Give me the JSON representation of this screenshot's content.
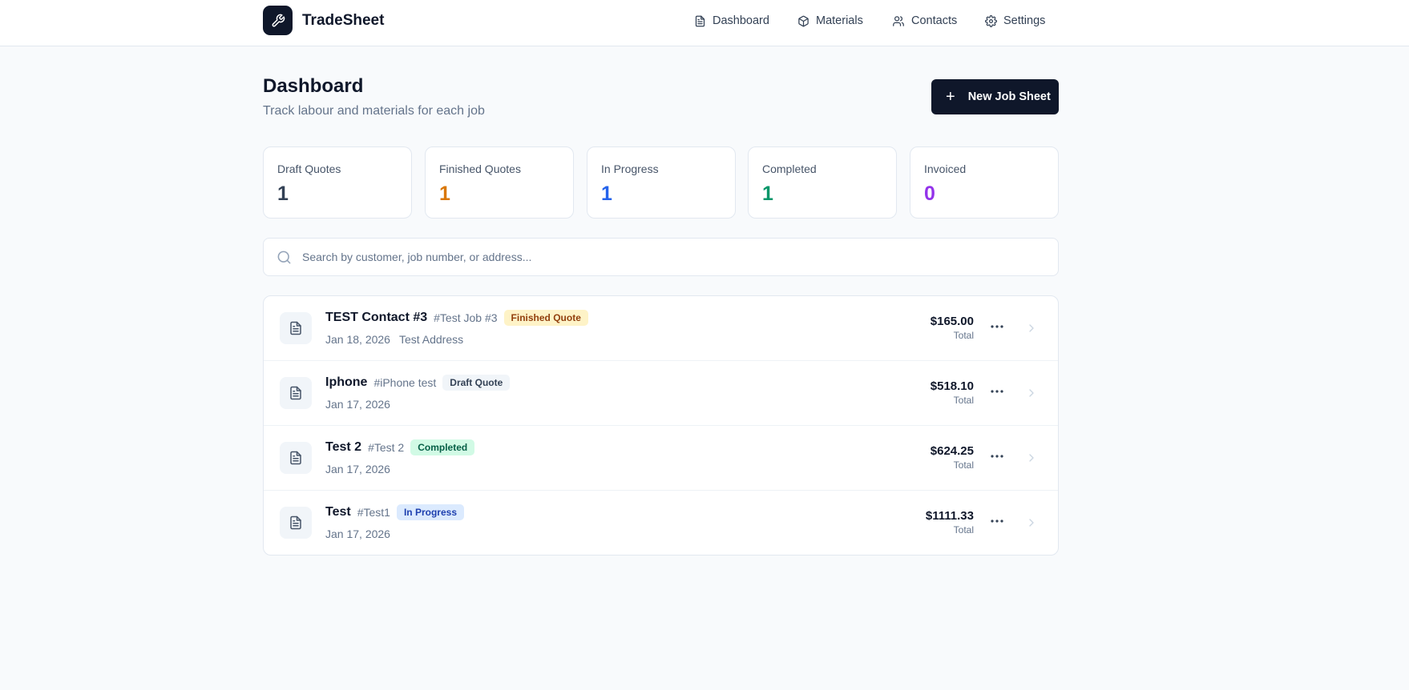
{
  "header": {
    "brand": "TradeSheet",
    "nav": [
      {
        "label": "Dashboard",
        "icon": "file-icon"
      },
      {
        "label": "Materials",
        "icon": "box-icon"
      },
      {
        "label": "Contacts",
        "icon": "users-icon"
      },
      {
        "label": "Settings",
        "icon": "gear-icon"
      }
    ]
  },
  "page": {
    "title": "Dashboard",
    "subtitle": "Track labour and materials for each job",
    "new_button": "New Job Sheet"
  },
  "stats": [
    {
      "label": "Draft Quotes",
      "value": "1",
      "color": "#334155"
    },
    {
      "label": "Finished Quotes",
      "value": "1",
      "color": "#d97706"
    },
    {
      "label": "In Progress",
      "value": "1",
      "color": "#2563eb"
    },
    {
      "label": "Completed",
      "value": "1",
      "color": "#059669"
    },
    {
      "label": "Invoiced",
      "value": "0",
      "color": "#9333ea"
    }
  ],
  "search": {
    "placeholder": "Search by customer, job number, or address..."
  },
  "jobs": [
    {
      "name": "TEST Contact #3",
      "number": "#Test Job #3",
      "status": "Finished Quote",
      "badge_bg": "#fef3c7",
      "badge_fg": "#92400e",
      "date": "Jan 18, 2026",
      "address": "Test Address",
      "amount": "$165.00",
      "amount_label": "Total"
    },
    {
      "name": "Iphone",
      "number": "#iPhone test",
      "status": "Draft Quote",
      "badge_bg": "#f1f5f9",
      "badge_fg": "#334155",
      "date": "Jan 17, 2026",
      "address": "",
      "amount": "$518.10",
      "amount_label": "Total"
    },
    {
      "name": "Test 2",
      "number": "#Test 2",
      "status": "Completed",
      "badge_bg": "#d1fae5",
      "badge_fg": "#065f46",
      "date": "Jan 17, 2026",
      "address": "",
      "amount": "$624.25",
      "amount_label": "Total"
    },
    {
      "name": "Test",
      "number": "#Test1",
      "status": "In Progress",
      "badge_bg": "#dbeafe",
      "badge_fg": "#1e40af",
      "date": "Jan 17, 2026",
      "address": "",
      "amount": "$1111.33",
      "amount_label": "Total"
    }
  ]
}
